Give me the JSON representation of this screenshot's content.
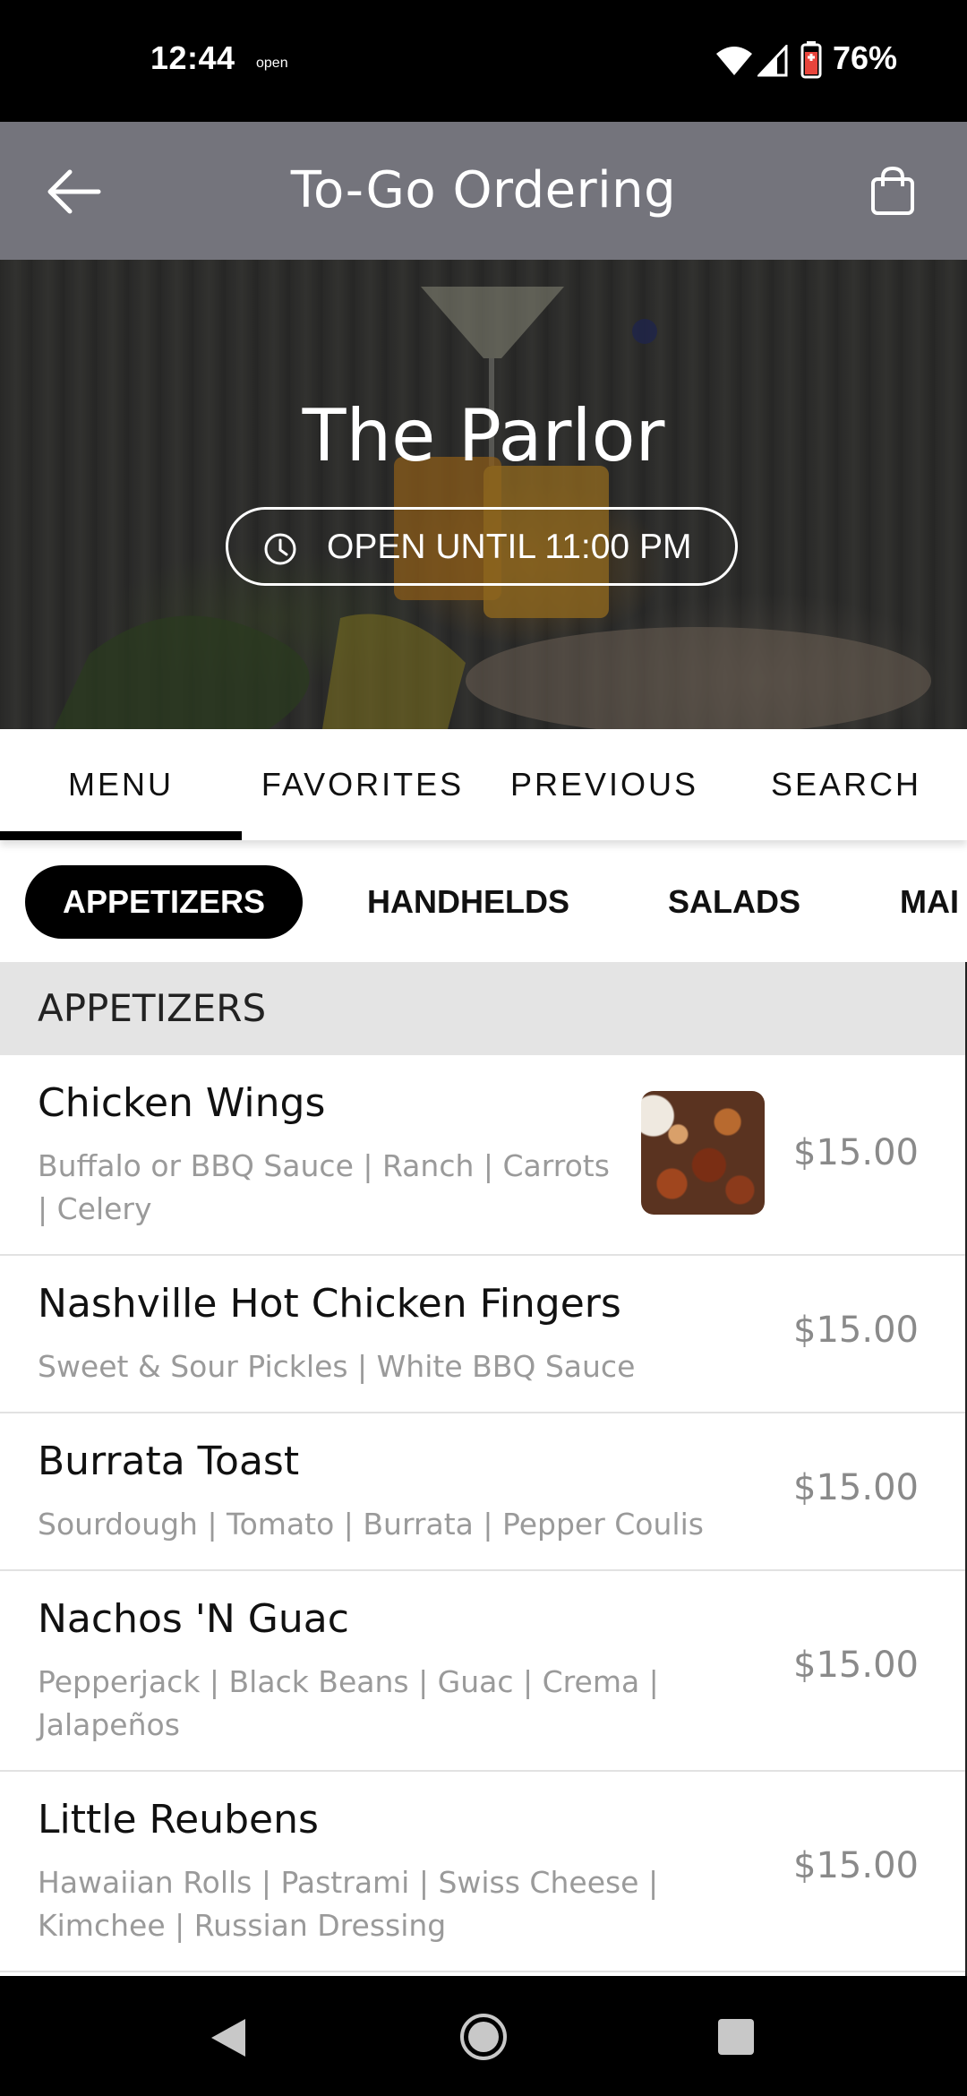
{
  "status_bar": {
    "time": "12:44",
    "extra": "open",
    "battery": "76%"
  },
  "app_bar": {
    "title": "To-Go Ordering",
    "back_icon": "arrow-left-icon",
    "cart_icon": "shopping-bag-icon"
  },
  "hero": {
    "restaurant_name": "The Parlor",
    "hours_label": "OPEN UNTIL 11:00 PM",
    "clock_icon": "clock-icon"
  },
  "tabs": [
    {
      "label": "MENU",
      "active": true
    },
    {
      "label": "FAVORITES",
      "active": false
    },
    {
      "label": "PREVIOUS",
      "active": false
    },
    {
      "label": "SEARCH",
      "active": false
    }
  ],
  "categories": [
    {
      "label": "APPETIZERS",
      "active": true
    },
    {
      "label": "HANDHELDS",
      "active": false
    },
    {
      "label": "SALADS",
      "active": false
    },
    {
      "label": "MAI",
      "active": false
    }
  ],
  "section_title": "APPETIZERS",
  "items": [
    {
      "name": "Chicken Wings",
      "desc1": "Buffalo or BBQ Sauce | Ranch | Carrots",
      "desc2": "| Celery",
      "price": "$15.00"
    },
    {
      "name": "Nashville Hot Chicken Fingers",
      "desc1": "Sweet & Sour Pickles | White BBQ Sauce",
      "desc2": "",
      "price": "$15.00"
    },
    {
      "name": "Burrata Toast",
      "desc1": "Sourdough | Tomato | Burrata | Pepper Coulis",
      "desc2": "",
      "price": "$15.00"
    },
    {
      "name": "Nachos 'N Guac",
      "desc1": "Pepperjack | Black Beans | Guac | Crema |",
      "desc2": "Jalapeños",
      "price": "$15.00"
    },
    {
      "name": "Little Reubens",
      "desc1": "Hawaiian Rolls | Pastrami | Swiss Cheese |",
      "desc2": "Kimchee | Russian Dressing",
      "price": "$15.00"
    }
  ],
  "nav_bar": {
    "back": "nav-back-icon",
    "home": "nav-home-icon",
    "recents": "nav-recents-icon"
  }
}
